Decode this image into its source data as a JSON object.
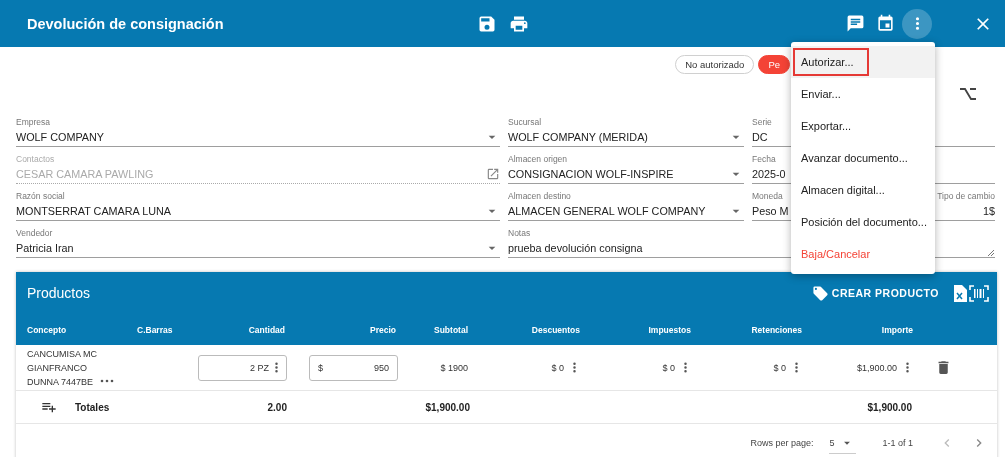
{
  "header": {
    "title": "Devolución de consignación"
  },
  "status_chips": [
    {
      "label": "No autorizado",
      "kind": "outlined"
    },
    {
      "label": "Pe",
      "kind": "filled"
    }
  ],
  "form_rows": [
    {
      "fields": [
        {
          "label": "Empresa",
          "value": "WOLF COMPANY",
          "kind": "select",
          "disabled": false
        },
        {
          "label": "Sucursal",
          "value": "WOLF COMPANY (MERIDA)",
          "kind": "select",
          "disabled": false
        },
        {
          "label": "Serie",
          "value": "DC",
          "kind": "text",
          "disabled": false
        }
      ]
    },
    {
      "fields": [
        {
          "label": "Contactos",
          "value": "CESAR CAMARA PAWLING",
          "kind": "link",
          "disabled": true
        },
        {
          "label": "Almacen origen",
          "value": "CONSIGNACION WOLF-INSPIRE",
          "kind": "select",
          "disabled": false
        },
        {
          "label": "Fecha",
          "value": "2025-0",
          "kind": "text",
          "disabled": false
        }
      ]
    },
    {
      "fields": [
        {
          "label": "Razón social",
          "value": "MONTSERRAT CAMARA LUNA",
          "kind": "select",
          "disabled": false
        },
        {
          "label": "Almacen destino",
          "value": "ALMACEN GENERAL WOLF COMPANY",
          "kind": "select",
          "disabled": false
        },
        {
          "label": "Moneda",
          "value": "Peso M",
          "kind": "text",
          "disabled": false
        },
        {
          "label": "Tipo de cambio",
          "value": "1$",
          "kind": "number",
          "disabled": false
        }
      ]
    },
    {
      "fields": [
        {
          "label": "Vendedor",
          "value": "Patricia Iran",
          "kind": "select",
          "disabled": false
        },
        {
          "label": "Notas",
          "value": "prueba devolución consigna",
          "kind": "textarea",
          "disabled": false
        }
      ]
    }
  ],
  "products": {
    "title": "Productos",
    "create_button": "CREAR PRODUCTO",
    "columns": [
      "Concepto",
      "C.Barras",
      "Cantidad",
      "Precio",
      "Subtotal",
      "Descuentos",
      "Impuestos",
      "Retenciones",
      "Importe"
    ],
    "rows": [
      {
        "concepto": "CANCUMISA MC GIANFRANCO DUNNA 7447BE",
        "cantidad": "2 PZ",
        "precio_prefix": "$",
        "precio": "950",
        "subtotal": "$ 1900",
        "descuentos": "$ 0",
        "impuestos": "$ 0",
        "retenciones": "$ 0",
        "importe": "$1,900.00"
      }
    ],
    "totals": {
      "label": "Totales",
      "cantidad": "2.00",
      "subtotal": "$1,900.00",
      "importe": "$1,900.00"
    },
    "pagination": {
      "rows_per_page_label": "Rows per page:",
      "rows_per_page": "5",
      "range": "1-1 of 1"
    }
  },
  "actions_menu": {
    "open": true,
    "items": [
      {
        "label": "Autorizar...",
        "kind": "normal",
        "selected": true
      },
      {
        "label": "Enviar...",
        "kind": "normal",
        "selected": false
      },
      {
        "label": "Exportar...",
        "kind": "normal",
        "selected": false
      },
      {
        "label": "Avanzar documento...",
        "kind": "normal",
        "selected": false
      },
      {
        "label": "Almacen digital...",
        "kind": "normal",
        "selected": false
      },
      {
        "label": "Posición del documento...",
        "kind": "normal",
        "selected": false
      },
      {
        "label": "Baja/Cancelar",
        "kind": "danger",
        "selected": false
      }
    ]
  }
}
